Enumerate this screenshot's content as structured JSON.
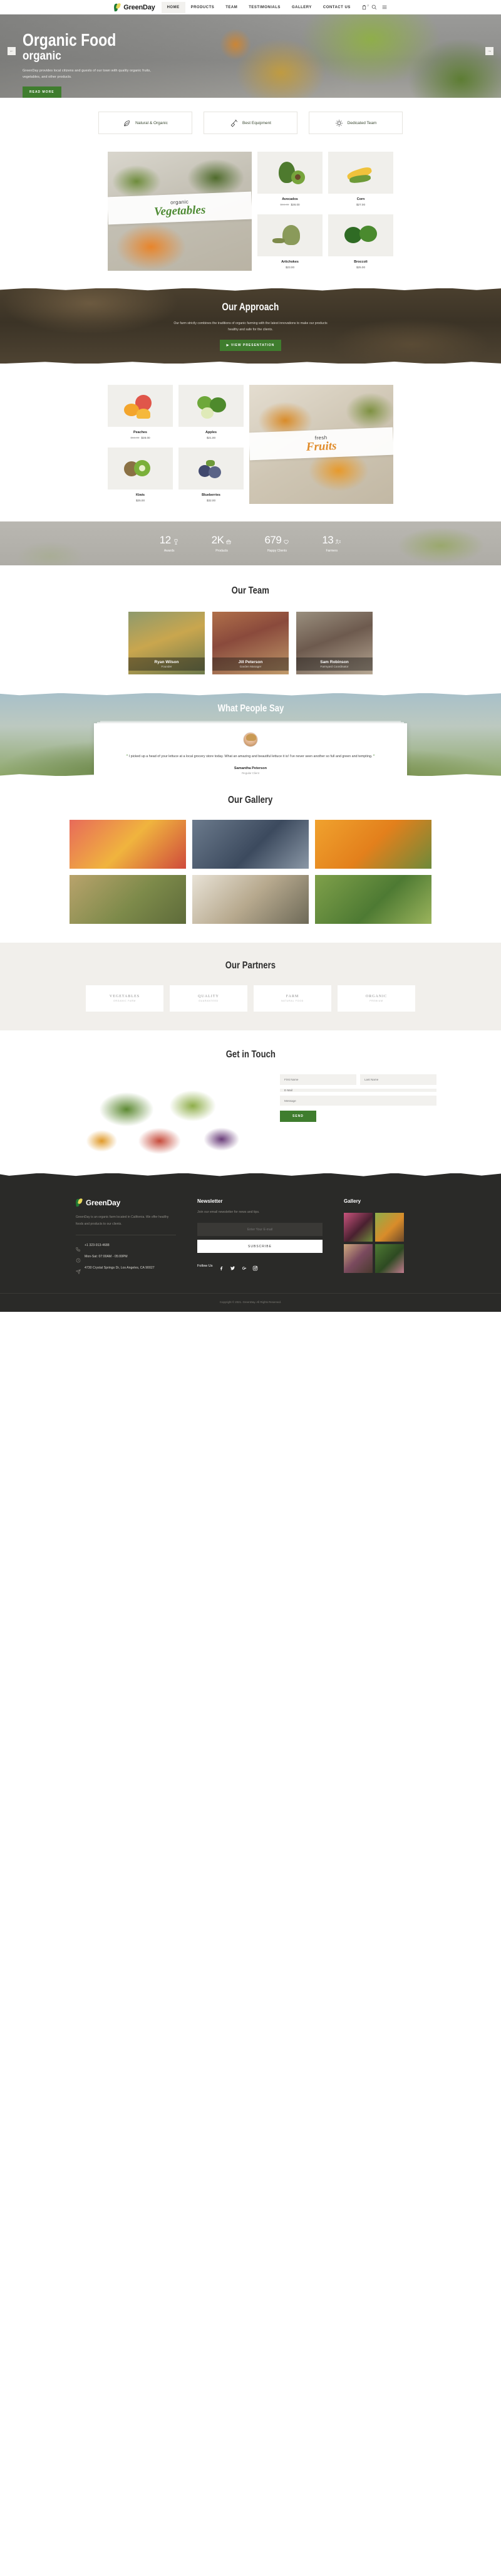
{
  "header": {
    "brand": "GreenDay",
    "nav": [
      {
        "label": "HOME",
        "active": true
      },
      {
        "label": "PRODUCTS",
        "active": false
      },
      {
        "label": "TEAM",
        "active": false
      },
      {
        "label": "TESTIMONIALS",
        "active": false
      },
      {
        "label": "GALLERY",
        "active": false
      },
      {
        "label": "CONTACT US",
        "active": false
      }
    ],
    "cart_count": "2"
  },
  "hero": {
    "title_line1": "Organic Food",
    "title_line2": "organic",
    "description": "GreenDay provides local citizens and guests of our town with quality organic fruits, vegetables, and other products.",
    "cta": "READ MORE",
    "prev": "←",
    "next": "→"
  },
  "features": [
    {
      "label": "Natural & Organic",
      "icon": "leaf-icon"
    },
    {
      "label": "Best Equipment",
      "icon": "shovel-icon"
    },
    {
      "label": "Dedicated Team",
      "icon": "sun-icon"
    }
  ],
  "vegetables": {
    "promo_small": "organic",
    "promo_big": "Vegetables",
    "products": [
      {
        "name": "Avocados",
        "old_price": "$59.00",
        "price": "$28.00"
      },
      {
        "name": "Corn",
        "old_price": "",
        "price": "$27.00"
      },
      {
        "name": "Artichokes",
        "old_price": "",
        "price": "$23.00"
      },
      {
        "name": "Broccoli",
        "old_price": "",
        "price": "$25.00"
      }
    ]
  },
  "approach": {
    "title": "Our Approach",
    "description": "Our farm strictly combines the traditions of organic farming with the latest innovations to make our products healthy and safe for the clients.",
    "cta": "VIEW PRESENTATION"
  },
  "fruits": {
    "promo_small": "fresh",
    "promo_big": "Fruits",
    "products": [
      {
        "name": "Peaches",
        "old_price": "$59.00",
        "price": "$28.00"
      },
      {
        "name": "Apples",
        "old_price": "",
        "price": "$21.00"
      },
      {
        "name": "Kiwis",
        "old_price": "",
        "price": "$25.00"
      },
      {
        "name": "Blueberries",
        "old_price": "",
        "price": "$32.00"
      }
    ]
  },
  "counters": [
    {
      "value": "12",
      "label": "Awards",
      "icon": "trophy-icon"
    },
    {
      "value": "2K",
      "label": "Products",
      "icon": "basket-icon"
    },
    {
      "value": "679",
      "label": "Happy Clients",
      "icon": "heart-icon"
    },
    {
      "value": "13",
      "label": "Farmers",
      "icon": "people-icon"
    }
  ],
  "team": {
    "title": "Our Team",
    "members": [
      {
        "name": "Ryan Wilson",
        "role": "Founder"
      },
      {
        "name": "Jill Peterson",
        "role": "Garden Manager"
      },
      {
        "name": "Sam Robinson",
        "role": "Farmyard Coordinator"
      }
    ]
  },
  "testimonials": {
    "title": "What People Say",
    "quote": "I picked up a head of your lettuce at a local grocery store today. What an amazing and beautiful lettuce it is! I've never seen another so full and green and tempting.",
    "author": "Samantha Peterson",
    "role": "Regular Client",
    "dots": 3,
    "active_dot": 1
  },
  "gallery": {
    "title": "Our Gallery"
  },
  "partners": {
    "title": "Our Partners",
    "items": [
      {
        "name": "VEGETABLES",
        "sub": "ORGANIC FARM"
      },
      {
        "name": "QUALITY",
        "sub": "GUARANTEED"
      },
      {
        "name": "FARM",
        "sub": "NATURAL FOOD"
      },
      {
        "name": "ORGANIC",
        "sub": "PREMIUM"
      }
    ]
  },
  "contact": {
    "title": "Get in Touch",
    "first_name_placeholder": "First Name",
    "last_name_placeholder": "Last Name",
    "email_placeholder": "E-Mail",
    "message_placeholder": "Message",
    "send_label": "SEND"
  },
  "footer": {
    "brand": "GreenDay",
    "description": "GreenDay is an organic farm located in California. We offer healthy foods and products to our clients.",
    "phone": "+1 323-913-4688",
    "hours": "Mon-Sat: 07:00AM - 05:00PM",
    "address": "4730 Crystal Springs Dr, Los Angeles, CA 90027",
    "newsletter_title": "Newsletter",
    "newsletter_sub": "Join our email newsletter for news and tips.",
    "email_placeholder": "Enter Your E-mail",
    "subscribe_label": "SUBSCRIBE",
    "follow_label": "Follow Us",
    "social": [
      "facebook-icon",
      "twitter-icon",
      "google-plus-icon",
      "instagram-icon"
    ],
    "gallery_title": "Gallery",
    "copyright": "Copyright © 2021. GreenDay. All Rights Reserved."
  },
  "colors": {
    "accent": "#3f7d2e",
    "dark": "#2a2a28",
    "light": "#f1efeb"
  }
}
